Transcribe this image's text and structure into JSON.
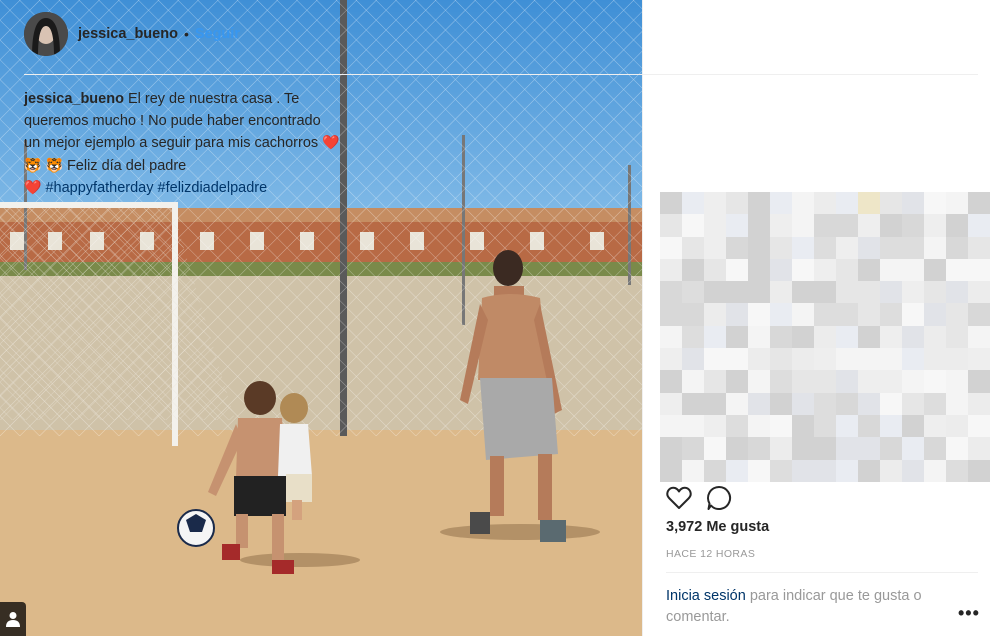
{
  "post": {
    "username": "jessica_bueno",
    "separator": "•",
    "follow_label": "Seguir",
    "caption": {
      "text_1": "El rey de nuestra casa . Te queremos mucho ! No pude haber encontrado un mejor ejemplo a seguir para mis cachorros",
      "emoji_heart": "❤️",
      "emoji_tiger": "🐯",
      "text_2": "Feliz día del padre",
      "hashtag_1": "#happyfatherday",
      "hashtag_2": "#felizdiadelpadre"
    },
    "likes": "3,972 Me gusta",
    "timestamp": "HACE 12 HORAS",
    "login_prompt": {
      "link": "Inicia sesión",
      "text": "para indicar que te gusta o comentar."
    },
    "more_label": "•••"
  },
  "icons": {
    "like": "heart-outline-icon",
    "comment": "comment-bubble-icon",
    "tagged_user": "person-tag-icon"
  },
  "colors": {
    "link_blue": "#3897f0",
    "hashtag": "#003569",
    "muted": "#999999",
    "text": "#262626"
  }
}
